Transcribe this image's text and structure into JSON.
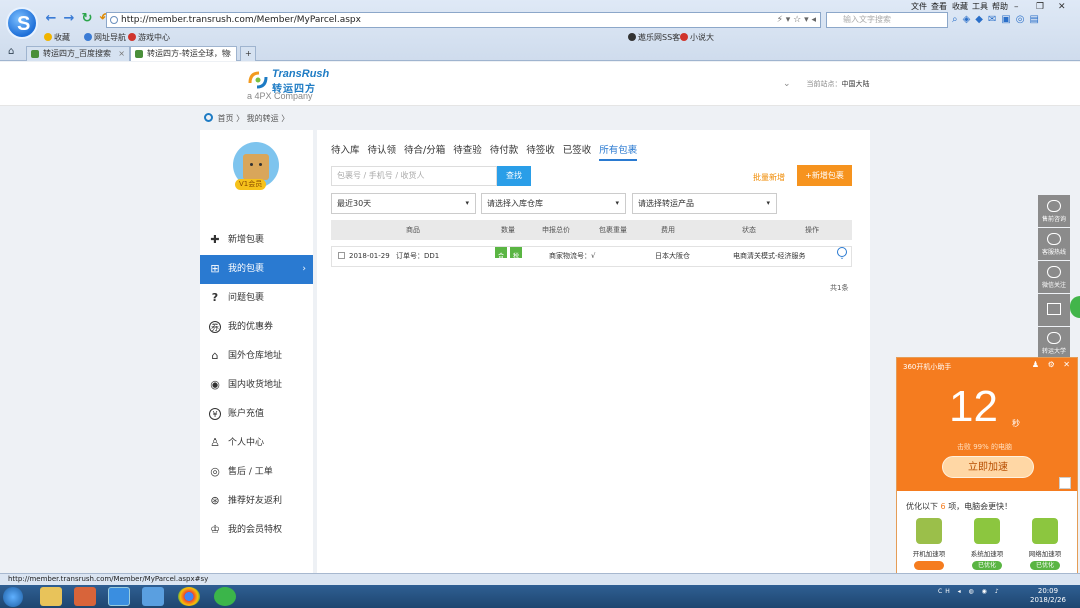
{
  "browser": {
    "url": "http://member.transrush.com/Member/MyParcel.aspx",
    "search_placeholder": "输入文字搜索",
    "menu": [
      "文件",
      "查看",
      "收藏",
      "工具",
      "帮助"
    ],
    "favorites_bar": [
      {
        "label": "收藏",
        "color": "#f0b400"
      },
      {
        "label": "网址导航",
        "color": "#3a7bd5"
      },
      {
        "label": "游戏中心",
        "color": "#d0342c"
      },
      {
        "label": "遨乐网SS客",
        "color": "#333333"
      },
      {
        "label": "小说大",
        "color": "#d0342c"
      }
    ],
    "tabs": [
      {
        "title": "转运四方_百度搜索",
        "active": false
      },
      {
        "title": "转运四方-转运全球，物",
        "active": true
      }
    ],
    "new_tab": "+",
    "logo_glyph": "S"
  },
  "site": {
    "brand_en": "TransRush",
    "brand_cn": "转运四方",
    "brand_sub": "a 4PX Company",
    "station_label": "当前站点：",
    "station_value": "中国大陆",
    "station_caret": "⌄"
  },
  "breadcrumb": {
    "home": "首页",
    "sep1": "〉",
    "current": "我的转运",
    "sep2": "〉"
  },
  "member": {
    "vip_label": "V1会员"
  },
  "sidebar": {
    "items": [
      {
        "label": "新增包裹",
        "icon": "plus-icon",
        "glyph": "✚",
        "active": false
      },
      {
        "label": "我的包裹",
        "icon": "gift-icon",
        "glyph": "⊞",
        "active": true
      },
      {
        "label": "问题包裹",
        "icon": "question-icon",
        "glyph": "?",
        "active": false
      },
      {
        "label": "我的优惠券",
        "icon": "coupon-icon",
        "glyph": "券",
        "active": false
      },
      {
        "label": "国外仓库地址",
        "icon": "warehouse-icon",
        "glyph": "⌂",
        "active": false
      },
      {
        "label": "国内收货地址",
        "icon": "location-icon",
        "glyph": "◉",
        "active": false
      },
      {
        "label": "账户充值",
        "icon": "yen-icon",
        "glyph": "¥",
        "active": false
      },
      {
        "label": "个人中心",
        "icon": "user-icon",
        "glyph": "♙",
        "active": false
      },
      {
        "label": "售后 / 工单",
        "icon": "service-icon",
        "glyph": "◎",
        "active": false
      },
      {
        "label": "推荐好友返利",
        "icon": "referral-icon",
        "glyph": "⊛",
        "active": false
      },
      {
        "label": "我的会员特权",
        "icon": "privilege-icon",
        "glyph": "♔",
        "active": false
      }
    ],
    "active_arrow": "›"
  },
  "main": {
    "status_tabs": [
      "待入库",
      "待认领",
      "待合/分箱",
      "待查验",
      "待付款",
      "待签收",
      "已签收",
      "所有包裹"
    ],
    "active_tab": "所有包裹",
    "search_placeholder": "包裹号 / 手机号 / 收货人",
    "search_button": "查找",
    "batch_add": "批量新增",
    "add_button": "+新增包裹",
    "filters": [
      {
        "value": "最近30天",
        "caret": "▾"
      },
      {
        "value": "请选择入库仓库",
        "caret": "▾"
      },
      {
        "value": "请选择转运产品",
        "caret": "▾"
      }
    ],
    "table": {
      "headers": [
        "商品",
        "数量",
        "申报总价",
        "包裹重量",
        "费用",
        "状态",
        "操作"
      ],
      "rows": [
        {
          "date": "2018-01-29",
          "order": "订单号：DD1",
          "tags": [
            "合",
            "税"
          ],
          "merchant": "商家物流号：√",
          "warehouse": "日本大阪仓",
          "status": "电商清关模式-经济服务",
          "expand": "⌄"
        }
      ]
    },
    "total": "共1条"
  },
  "float_toolbar": [
    {
      "label": "售前咨询"
    },
    {
      "label": "客服热线"
    },
    {
      "label": "微信关注"
    },
    {
      "label": ""
    },
    {
      "label": "转运大学"
    }
  ],
  "popup360": {
    "title": "360开机小助手",
    "controls": "♟ ⚙ ✕",
    "seconds": "12",
    "unit": "秒",
    "beat_text": "击败 99% 的电脑",
    "button": "立即加速",
    "optimize_prefix": "优化以下",
    "optimize_count": "6",
    "optimize_suffix": "项，电脑会更快！",
    "items": [
      {
        "label": "开机加速项",
        "state": ""
      },
      {
        "label": "系统加速项",
        "state": "已优化"
      },
      {
        "label": "网络加速项",
        "state": "已优化"
      }
    ]
  },
  "statusbar": {
    "text": "http://member.transrush.com/Member/MyParcel.aspx#sy"
  },
  "taskbar": {
    "time": "20:09",
    "date": "2018/2/26",
    "tray": "CH ◂ ◍ ◉ ♪"
  }
}
